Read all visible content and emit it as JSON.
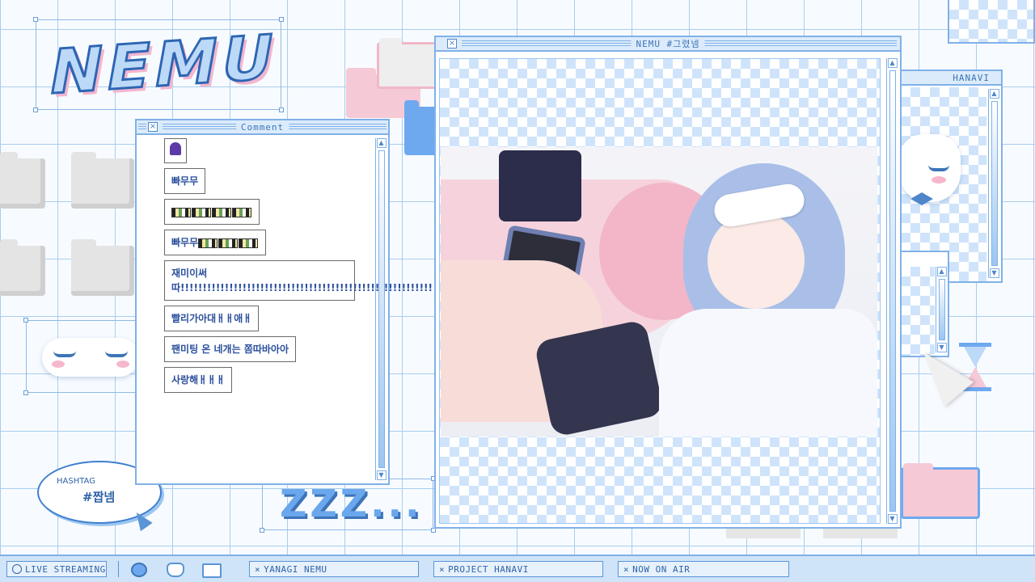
{
  "logo": {
    "text": "NEMU"
  },
  "comment_window": {
    "title": "Comment",
    "comments": [
      {
        "text": "빠무무"
      },
      {
        "text": "",
        "emotes": 6
      },
      {
        "text": "빠무무",
        "emotes": 5
      },
      {
        "text": "재미이써 따!!!!!!!!!!!!!!!!!!!!!!!!!!!!!!!!!!!!!!!!!!!!!!!!!!!!!!!!!"
      },
      {
        "text": "빨리가아대ㅐㅐ애ㅐ"
      },
      {
        "text": "팬미팅 온 네개는 쫌따바아아"
      },
      {
        "text": "사랑해ㅐㅐㅐ"
      }
    ]
  },
  "main_window": {
    "title": "NEMU #그렸넴"
  },
  "hanavi_window": {
    "title": "HANAVI"
  },
  "hashtag": {
    "label": "HASHTAG",
    "tag": "#짭넴"
  },
  "sleep_text": "ZZZ...",
  "taskbar": {
    "live": "LIVE STREAMING",
    "tab1": "YANAGI NEMU",
    "tab2": "PROJECT HANAVI",
    "tab3": "NOW ON AIR"
  },
  "colors": {
    "accent": "#7fb1e8",
    "text": "#2f63a8",
    "pink": "#f6c9d6"
  }
}
